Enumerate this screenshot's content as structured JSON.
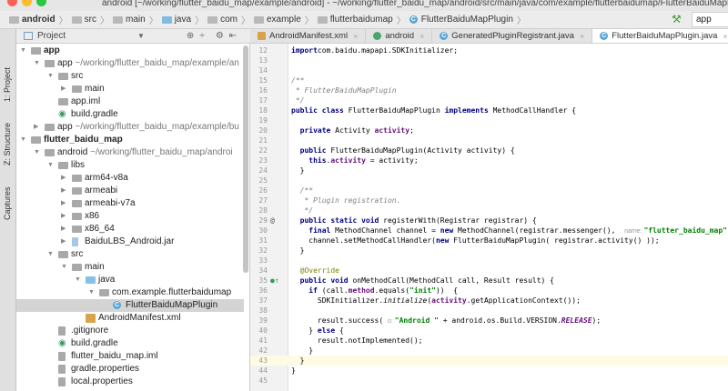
{
  "window": {
    "title": "android [~/working/flutter_baidu_map/example/android] - ~/working/flutter_baidu_map/android/src/main/java/com/example/flutterbaidumap/FlutterBaiduMapPlugin.java"
  },
  "breadcrumb": [
    "android",
    "src",
    "main",
    "java",
    "com",
    "example",
    "flutterbaidumap",
    "FlutterBaiduMapPlugin"
  ],
  "toolbar": {
    "run_config": "app",
    "build_icon": "hammer-icon"
  },
  "side_strip": {
    "items": [
      "1: Project",
      "Z: Structure",
      "Captures"
    ]
  },
  "project_panel": {
    "title": "Project"
  },
  "tabs": [
    {
      "label": "AndroidManifest.xml",
      "icon": "xml-icon",
      "active": false
    },
    {
      "label": "android",
      "icon": "gradle-icon",
      "active": false
    },
    {
      "label": "GeneratedPluginRegistrant.java",
      "icon": "class-icon",
      "active": false
    },
    {
      "label": "FlutterBaiduMapPlugin.java",
      "icon": "class-icon",
      "active": true
    }
  ],
  "tree": [
    {
      "label": "app",
      "level": 0,
      "arrow": "down",
      "bold": true
    },
    {
      "label": "app",
      "path": "~/working/flutter_baidu_map/example/an",
      "level": 1,
      "arrow": "down"
    },
    {
      "label": "src",
      "level": 2,
      "arrow": "down"
    },
    {
      "label": "main",
      "level": 3,
      "arrow": "right"
    },
    {
      "label": "app.iml",
      "level": 2
    },
    {
      "label": "build.gradle",
      "level": 2,
      "icon": "gradle"
    },
    {
      "label": "app",
      "path": "~/working/flutter_baidu_map/example/bu",
      "level": 1,
      "arrow": "right"
    },
    {
      "label": "flutter_baidu_map",
      "level": 0,
      "arrow": "down",
      "bold": true
    },
    {
      "label": "android",
      "path": "~/working/flutter_baidu_map/androi",
      "level": 1,
      "arrow": "down"
    },
    {
      "label": "libs",
      "level": 2,
      "arrow": "down"
    },
    {
      "label": "arm64-v8a",
      "level": 3,
      "arrow": "right"
    },
    {
      "label": "armeabi",
      "level": 3,
      "arrow": "right"
    },
    {
      "label": "armeabi-v7a",
      "level": 3,
      "arrow": "right"
    },
    {
      "label": "x86",
      "level": 3,
      "arrow": "right"
    },
    {
      "label": "x86_64",
      "level": 3,
      "arrow": "right"
    },
    {
      "label": "BaiduLBS_Android.jar",
      "level": 3,
      "arrow": "right",
      "icon": "jar"
    },
    {
      "label": "src",
      "level": 2,
      "arrow": "down"
    },
    {
      "label": "main",
      "level": 3,
      "arrow": "down"
    },
    {
      "label": "java",
      "level": 4,
      "arrow": "down",
      "icon": "blue"
    },
    {
      "label": "com.example.flutterbaidumap",
      "level": 5,
      "arrow": "down"
    },
    {
      "label": "FlutterBaiduMapPlugin",
      "level": 6,
      "icon": "class",
      "selected": true
    },
    {
      "label": "AndroidManifest.xml",
      "level": 4,
      "icon": "xml"
    },
    {
      "label": ".gitignore",
      "level": 2,
      "icon": "file"
    },
    {
      "label": "build.gradle",
      "level": 2,
      "icon": "gradle"
    },
    {
      "label": "flutter_baidu_map.iml",
      "level": 2,
      "icon": "file"
    },
    {
      "label": "gradle.properties",
      "level": 2,
      "icon": "file"
    },
    {
      "label": "local.properties",
      "level": 2,
      "icon": "file"
    }
  ],
  "editor": {
    "current_line": 43,
    "lines": [
      {
        "n": 12,
        "t": [
          [
            "kw",
            "import"
          ],
          [
            "",
            "com.baidu.mapapi.SDKInitializer;"
          ]
        ]
      },
      {
        "n": 13,
        "t": []
      },
      {
        "n": 14,
        "t": []
      },
      {
        "n": 15,
        "t": [
          [
            "cm",
            "/**"
          ]
        ]
      },
      {
        "n": 16,
        "t": [
          [
            "cm",
            " * FlutterBaiduMapPlugin"
          ]
        ]
      },
      {
        "n": 17,
        "t": [
          [
            "cm",
            " */"
          ]
        ]
      },
      {
        "n": 18,
        "t": [
          [
            "kw",
            "public class "
          ],
          [
            "",
            "FlutterBaiduMapPlugin "
          ],
          [
            "kw",
            "implements "
          ],
          [
            "",
            "MethodCallHandler {"
          ]
        ]
      },
      {
        "n": 19,
        "t": []
      },
      {
        "n": 20,
        "t": [
          [
            "",
            "  "
          ],
          [
            "kw",
            "private "
          ],
          [
            "",
            "Activity "
          ],
          [
            "fd",
            "activity"
          ],
          [
            "",
            ";"
          ]
        ]
      },
      {
        "n": 21,
        "t": []
      },
      {
        "n": 22,
        "t": [
          [
            "",
            "  "
          ],
          [
            "kw",
            "public "
          ],
          [
            "",
            "FlutterBaiduMapPlugin(Activity activity) {"
          ]
        ]
      },
      {
        "n": 23,
        "t": [
          [
            "",
            "    "
          ],
          [
            "kw",
            "this"
          ],
          [
            "",
            "."
          ],
          [
            "fd",
            "activity"
          ],
          [
            "",
            " = activity;"
          ]
        ]
      },
      {
        "n": 24,
        "t": [
          [
            "",
            "  }"
          ]
        ]
      },
      {
        "n": 25,
        "t": []
      },
      {
        "n": 26,
        "t": [
          [
            "cm",
            "  /**"
          ]
        ]
      },
      {
        "n": 27,
        "t": [
          [
            "cm",
            "   * Plugin registration."
          ]
        ]
      },
      {
        "n": 28,
        "t": [
          [
            "cm",
            "   */"
          ]
        ]
      },
      {
        "n": 29,
        "m": "@",
        "t": [
          [
            "",
            "  "
          ],
          [
            "kw",
            "public static void "
          ],
          [
            "",
            "registerWith(Registrar registrar) {"
          ]
        ]
      },
      {
        "n": 30,
        "t": [
          [
            "",
            "    "
          ],
          [
            "kw",
            "final "
          ],
          [
            "",
            "MethodChannel channel = "
          ],
          [
            "kw",
            "new "
          ],
          [
            "",
            "MethodChannel(registrar.messenger(),  "
          ],
          [
            "hint",
            "name: "
          ],
          [
            "st",
            "\"flutter_baidu_map\""
          ]
        ]
      },
      {
        "n": 31,
        "t": [
          [
            "",
            "    channel.setMethodCallHandler("
          ],
          [
            "kw",
            "new "
          ],
          [
            "",
            "FlutterBaiduMapPlugin( registrar.activity() ));"
          ]
        ]
      },
      {
        "n": 32,
        "t": [
          [
            "",
            "  }"
          ]
        ]
      },
      {
        "n": 33,
        "t": []
      },
      {
        "n": 34,
        "t": [
          [
            "an",
            "  @Override"
          ]
        ]
      },
      {
        "n": 35,
        "m": "●↑",
        "t": [
          [
            "",
            "  "
          ],
          [
            "kw",
            "public void "
          ],
          [
            "",
            "onMethodCall(MethodCall call, Result result) {"
          ]
        ]
      },
      {
        "n": 36,
        "t": [
          [
            "",
            "    "
          ],
          [
            "kw",
            "if "
          ],
          [
            "",
            "(call."
          ],
          [
            "fd",
            "method"
          ],
          [
            "",
            ".equals("
          ],
          [
            "st",
            "\"init\""
          ],
          [
            "",
            "))  {"
          ]
        ]
      },
      {
        "n": 37,
        "t": [
          [
            "",
            "      SDKInitializer."
          ],
          [
            "it",
            "initialize"
          ],
          [
            "",
            "("
          ],
          [
            "fd",
            "activity"
          ],
          [
            "",
            ".getApplicationContext());"
          ]
        ]
      },
      {
        "n": 38,
        "t": []
      },
      {
        "n": 39,
        "t": [
          [
            "",
            "      result.success( "
          ],
          [
            "hint",
            "o: "
          ],
          [
            "st",
            "\"Android \""
          ],
          [
            "",
            " + android.os.Build.VERSION."
          ],
          [
            "fdi",
            "RELEASE"
          ],
          [
            "",
            ");"
          ]
        ]
      },
      {
        "n": 40,
        "t": [
          [
            "",
            "    } "
          ],
          [
            "kw",
            "else "
          ],
          [
            "",
            "{"
          ]
        ]
      },
      {
        "n": 41,
        "t": [
          [
            "",
            "      result.notImplemented();"
          ]
        ]
      },
      {
        "n": 42,
        "t": [
          [
            "",
            "    }"
          ]
        ]
      },
      {
        "n": 43,
        "t": [
          [
            "",
            "  }"
          ]
        ]
      },
      {
        "n": 44,
        "t": [
          [
            "",
            "}"
          ]
        ]
      },
      {
        "n": 45,
        "t": []
      }
    ]
  },
  "colors": {
    "keyword": "#000080",
    "string": "#008000",
    "field": "#660e7a",
    "comment": "#808080",
    "selection": "#d4d4d4",
    "current_line": "#fdfbe3"
  }
}
